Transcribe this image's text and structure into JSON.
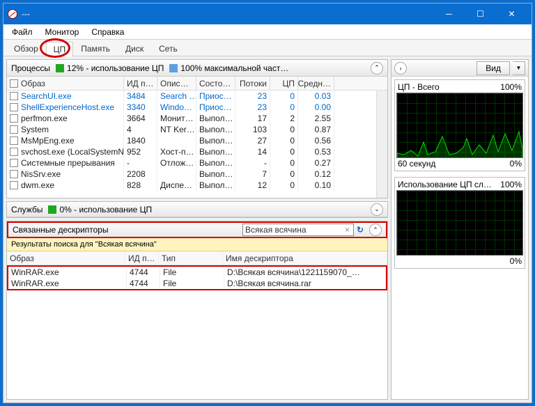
{
  "window": {
    "title": "---"
  },
  "menu": {
    "file": "Файл",
    "monitor": "Монитор",
    "help": "Справка"
  },
  "tabs": {
    "overview": "Обзор",
    "cpu": "ЦП",
    "memory": "Память",
    "disk": "Диск",
    "network": "Сеть"
  },
  "processes": {
    "title": "Процессы",
    "meter1": "12% - использование ЦП",
    "meter2": "100% максимальной част…",
    "cols": {
      "image": "Образ",
      "pid": "ИД п…",
      "desc": "Опис…",
      "status": "Состо…",
      "threads": "Потоки",
      "cpu": "ЦП",
      "avg": "Средн…"
    },
    "rows": [
      {
        "image": "SearchUI.exe",
        "pid": "3484",
        "desc": "Search …",
        "status": "Приос…",
        "threads": "23",
        "cpu": "0",
        "avg": "0.03",
        "sel": true
      },
      {
        "image": "ShellExperienceHost.exe",
        "pid": "3340",
        "desc": "Windo…",
        "status": "Приос…",
        "threads": "23",
        "cpu": "0",
        "avg": "0.00",
        "sel": true
      },
      {
        "image": "perfmon.exe",
        "pid": "3664",
        "desc": "Монит…",
        "status": "Выпол…",
        "threads": "17",
        "cpu": "2",
        "avg": "2.55"
      },
      {
        "image": "System",
        "pid": "4",
        "desc": "NT Ker…",
        "status": "Выпол…",
        "threads": "103",
        "cpu": "0",
        "avg": "0.87"
      },
      {
        "image": "MsMpEng.exe",
        "pid": "1840",
        "desc": "",
        "status": "Выпол…",
        "threads": "27",
        "cpu": "0",
        "avg": "0.56"
      },
      {
        "image": "svchost.exe (LocalSystemNet…",
        "pid": "952",
        "desc": "Хост-п…",
        "status": "Выпол…",
        "threads": "14",
        "cpu": "0",
        "avg": "0.53"
      },
      {
        "image": "Системные прерывания",
        "pid": "-",
        "desc": "Отлож…",
        "status": "Выпол…",
        "threads": "-",
        "cpu": "0",
        "avg": "0.27"
      },
      {
        "image": "NisSrv.exe",
        "pid": "2208",
        "desc": "",
        "status": "Выпол…",
        "threads": "7",
        "cpu": "0",
        "avg": "0.12"
      },
      {
        "image": "dwm.exe",
        "pid": "828",
        "desc": "Диспе…",
        "status": "Выпол…",
        "threads": "12",
        "cpu": "0",
        "avg": "0.10"
      }
    ]
  },
  "services": {
    "title": "Службы",
    "meter1": "0% - использование ЦП"
  },
  "handles": {
    "title": "Связанные дескрипторы",
    "search_value": "Всякая всячина",
    "results_hdr": "Результаты поиска для \"Всякая всячина\"",
    "cols": {
      "image": "Образ",
      "pid": "ИД п…",
      "type": "Тип",
      "name": "Имя дескриптора"
    },
    "rows": [
      {
        "image": "WinRAR.exe",
        "pid": "4744",
        "type": "File",
        "name": "D:\\Всякая всячина\\1221159070_…"
      },
      {
        "image": "WinRAR.exe",
        "pid": "4744",
        "type": "File",
        "name": "D:\\Всякая всячина.rar"
      }
    ]
  },
  "right": {
    "view": "Вид",
    "g1": {
      "title": "ЦП - Всего",
      "pct": "100%",
      "foot_l": "60 секунд",
      "foot_r": "0%"
    },
    "g2": {
      "title": "Использование ЦП сл…",
      "pct": "100%",
      "foot_l": "",
      "foot_r": "0%"
    }
  }
}
